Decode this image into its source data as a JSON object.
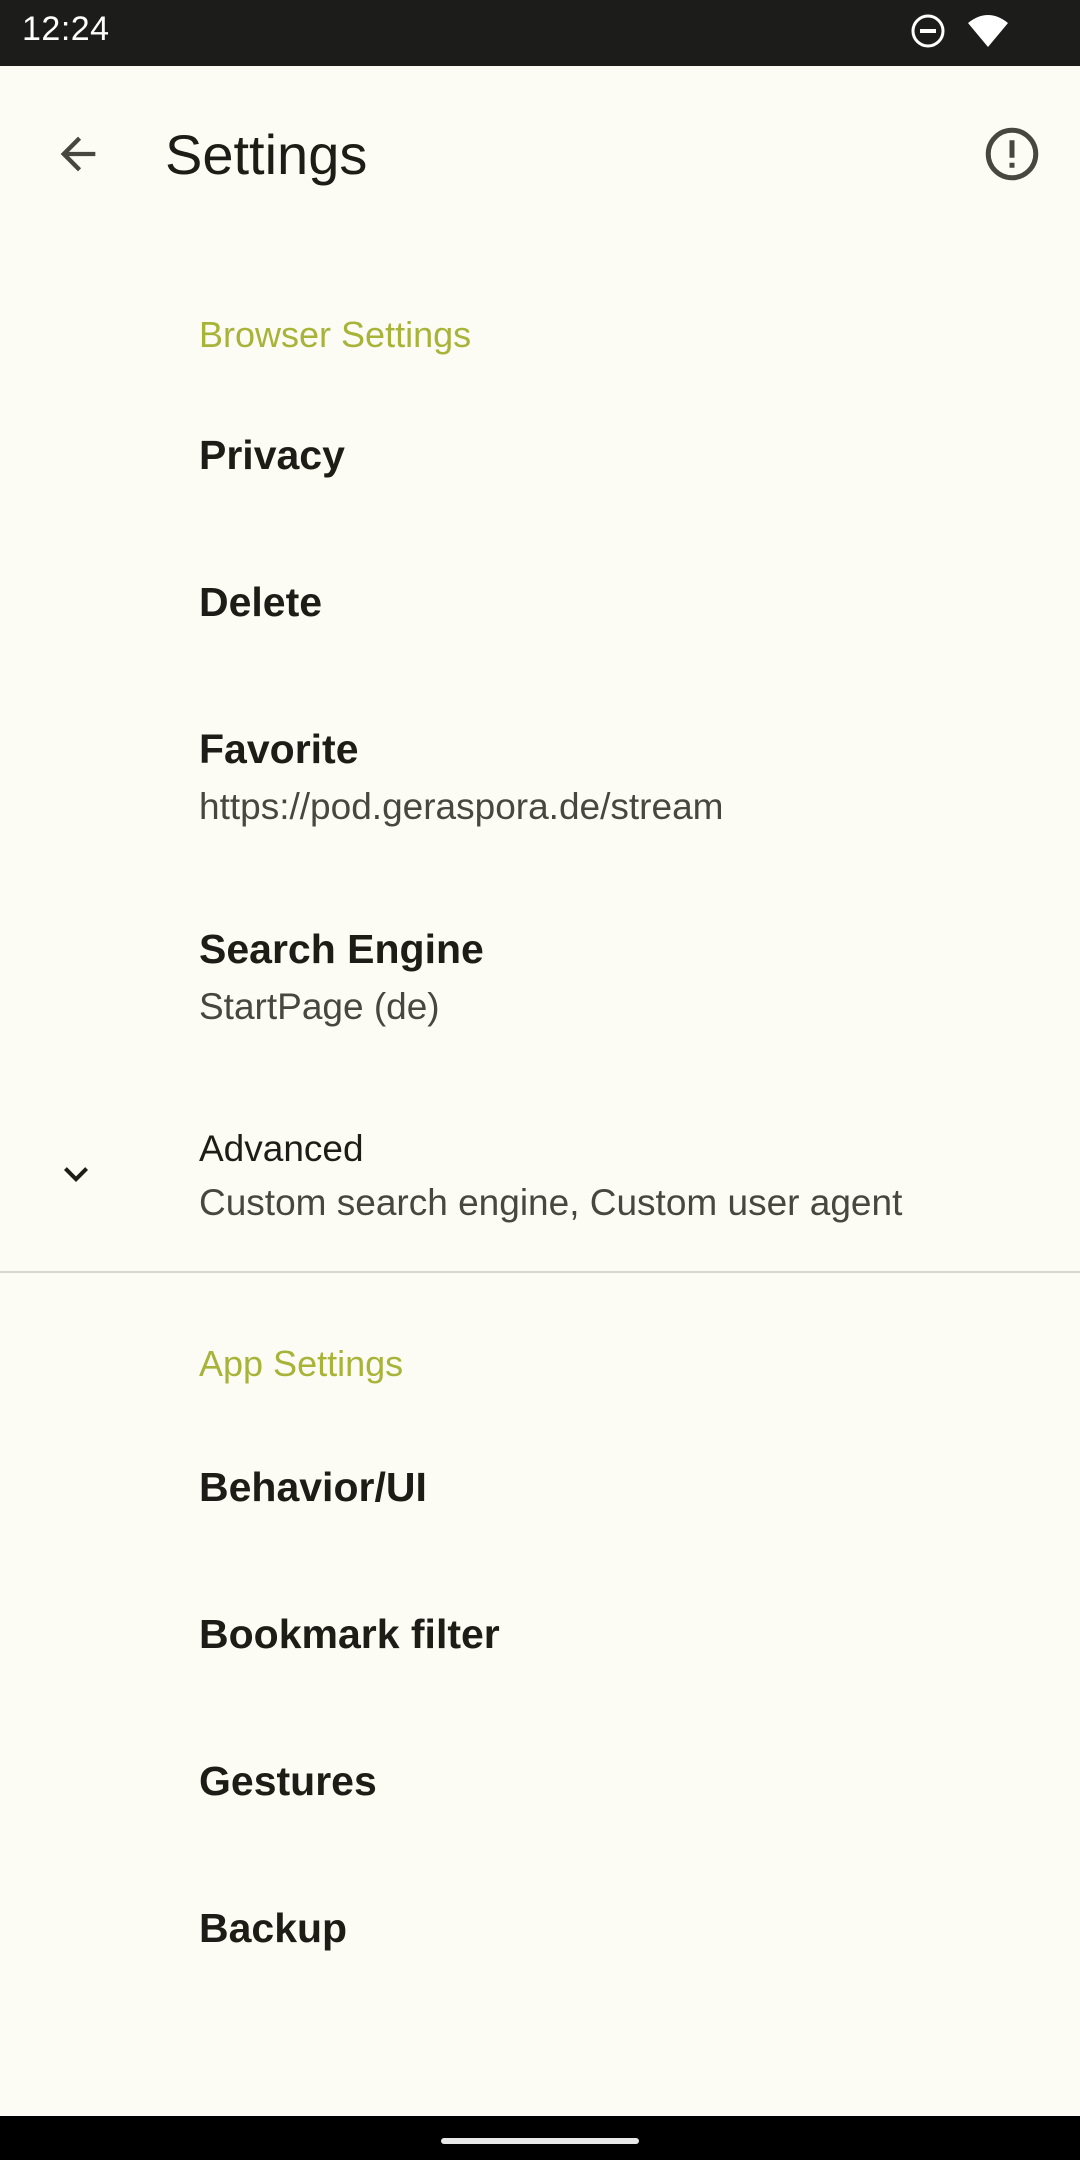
{
  "status_bar": {
    "time": "12:24",
    "icons": [
      "do-not-disturb-icon",
      "wifi-icon"
    ]
  },
  "app_bar": {
    "title": "Settings",
    "back_icon": "arrow-back-icon",
    "info_icon": "exclamation-circle-icon"
  },
  "browser_settings": {
    "header": "Browser Settings",
    "items": [
      {
        "title": "Privacy"
      },
      {
        "title": "Delete"
      },
      {
        "title": "Favorite",
        "summary": "https://pod.geraspora.de/stream"
      },
      {
        "title": "Search Engine",
        "summary": "StartPage (de)"
      }
    ],
    "advanced": {
      "title": "Advanced",
      "summary": "Custom search engine, Custom user agent",
      "icon": "chevron-down-icon"
    }
  },
  "app_settings": {
    "header": "App Settings",
    "items": [
      {
        "title": "Behavior/UI"
      },
      {
        "title": "Bookmark filter"
      },
      {
        "title": "Gestures"
      },
      {
        "title": "Backup"
      }
    ]
  },
  "colors": {
    "background": "#fdfcf4",
    "accent": "#a8b33a",
    "text_primary": "#1d1c17",
    "text_secondary": "#48473f"
  }
}
